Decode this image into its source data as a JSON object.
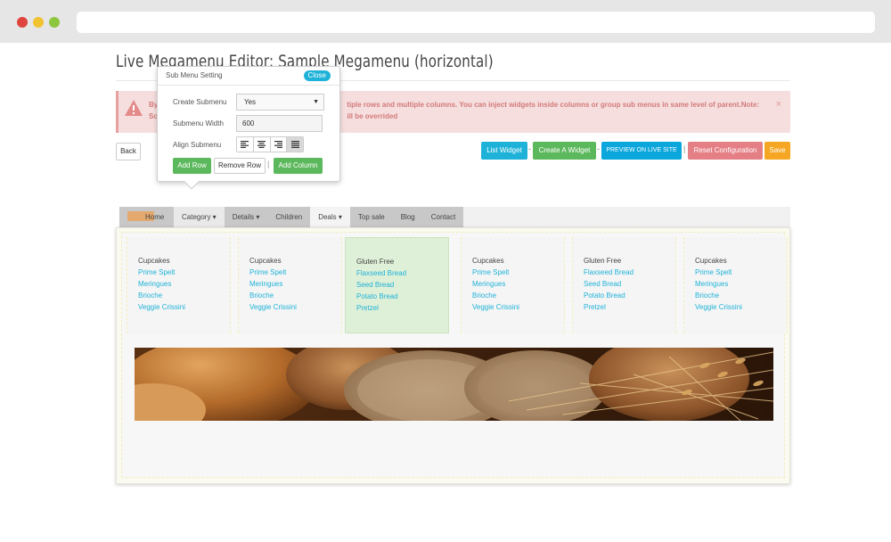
{
  "page": {
    "title": "Live Megamenu Editor: Sample Megamenu (horizontal)"
  },
  "alert": {
    "line1_left": "By",
    "line1_right": "tiple rows and multiple columns. You can inject widgets inside columns or group sub menus in same level of parent.Note:",
    "line2_left": "Sor",
    "line2_right": "ill be overrided",
    "close": "×"
  },
  "toolbar": {
    "back": "Back",
    "list_widget": "List Widget",
    "create_widget": "Create A Widget",
    "preview": "PREVIEW ON LIVE SITE",
    "reset": "Reset Configuration",
    "save": "Save",
    "sep_dash": "-",
    "sep_bar": "|"
  },
  "popover": {
    "title": "Sub Menu Setting",
    "close": "Close",
    "create_label": "Create Submenu",
    "create_value": "Yes",
    "width_label": "Submenu Width",
    "width_value": "600",
    "align_label": "Align Submenu",
    "add_row": "Add Row",
    "remove_row": "Remove Row",
    "sep": "|",
    "add_column": "Add Column"
  },
  "menu": {
    "items": [
      "Home",
      "Category ▾",
      "Details ▾",
      "Children",
      "Deals ▾",
      "Top sale",
      "Blog",
      "Contact"
    ]
  },
  "columns": [
    {
      "title": "Cupcakes",
      "links": [
        "Prime Spelt",
        "Meringues",
        "Brioche",
        "Veggie Crissini"
      ]
    },
    {
      "title": "Cupcakes",
      "links": [
        "Prime Spelt",
        "Meringues",
        "Brioche",
        "Veggie Crissini"
      ]
    },
    {
      "title": "Gluten Free",
      "links": [
        "Flaxseed Bread",
        "Seed Bread",
        "Potato Bread",
        "Pretzel"
      ]
    },
    {
      "title": "Cupcakes",
      "links": [
        "Prime Spelt",
        "Meringues",
        "Brioche",
        "Veggie Crissini"
      ]
    },
    {
      "title": "Gluten Free",
      "links": [
        "Flaxseed Bread",
        "Seed Bread",
        "Potato Bread",
        "Pretzel"
      ]
    },
    {
      "title": "Cupcakes",
      "links": [
        "Prime Spelt",
        "Meringues",
        "Brioche",
        "Veggie Crissini"
      ]
    }
  ],
  "colors": {
    "accent_blue": "#1fb2d8",
    "success_green": "#5cb85c",
    "danger_pink": "#e57f86",
    "warning_orange": "#f5a623"
  }
}
